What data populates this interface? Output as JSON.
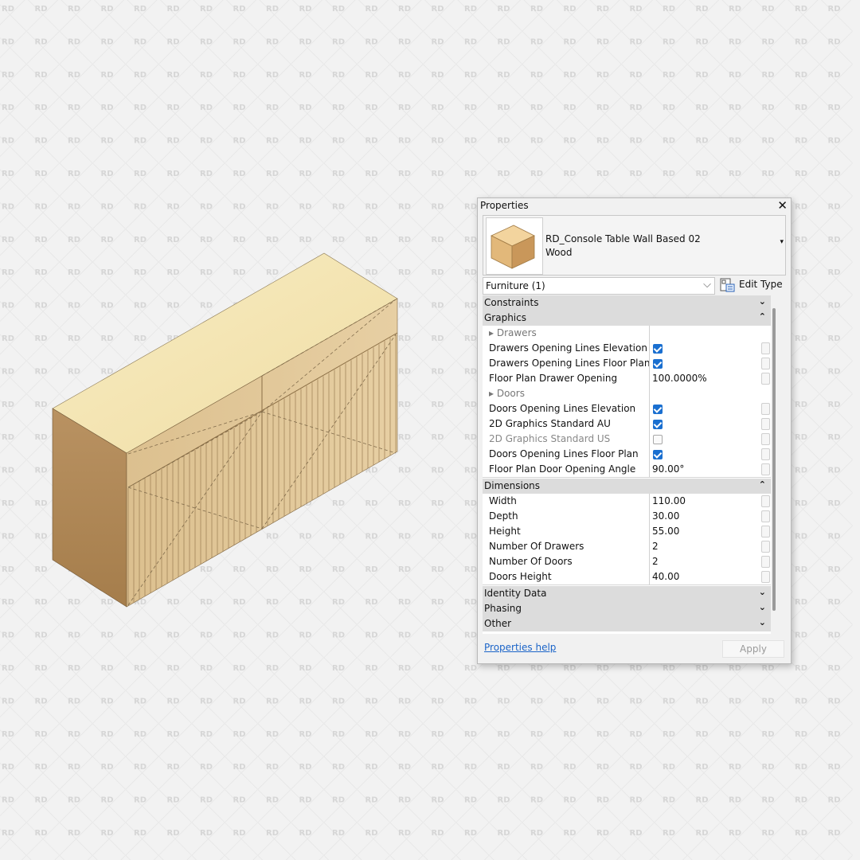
{
  "watermark": {
    "text": "RD"
  },
  "colors": {
    "accent": "#1a6fd0",
    "link": "#1b64c8",
    "wood_top": "#f4e7b2",
    "wood_front": "#e4c798",
    "wood_side": "#b18a57"
  },
  "panel": {
    "title": "Properties",
    "close_glyph": "✕",
    "type_name_line1": "RD_Console Table Wall Based 02",
    "type_name_line2": "Wood",
    "type_dropdown_glyph": "▾",
    "filter_value": "Furniture (1)",
    "filter_chevron": "⌵",
    "edit_type_label": "Edit Type",
    "help_link": "Properties help",
    "apply_label": "Apply"
  },
  "groups": {
    "constraints": {
      "label": "Constraints",
      "arrow": "⌄"
    },
    "graphics": {
      "label": "Graphics",
      "arrow": "⌃"
    },
    "dimensions": {
      "label": "Dimensions",
      "arrow": "⌃"
    },
    "identity": {
      "label": "Identity Data",
      "arrow": "⌄"
    },
    "phasing": {
      "label": "Phasing",
      "arrow": "⌄"
    },
    "other": {
      "label": "Other",
      "arrow": "⌄"
    }
  },
  "graphics_rows": [
    {
      "name": "▸ Drawers",
      "kind": "sub"
    },
    {
      "name": "Drawers Opening Lines Elevation",
      "kind": "check",
      "checked": true
    },
    {
      "name": "Drawers Opening Lines Floor Plan",
      "kind": "check",
      "checked": true
    },
    {
      "name": "Floor Plan Drawer Opening",
      "kind": "value",
      "value": "100.0000%"
    },
    {
      "name": "▸ Doors",
      "kind": "sub"
    },
    {
      "name": "Doors Opening Lines Elevation",
      "kind": "check",
      "checked": true
    },
    {
      "name": "2D Graphics Standard AU",
      "kind": "check",
      "checked": true
    },
    {
      "name": "2D Graphics Standard US",
      "kind": "check",
      "checked": false,
      "dim": true
    },
    {
      "name": "Doors Opening Lines Floor Plan",
      "kind": "check",
      "checked": true
    },
    {
      "name": "Floor Plan Door Opening Angle",
      "kind": "value",
      "value": "90.00°"
    }
  ],
  "dimension_rows": [
    {
      "name": "Width",
      "kind": "value",
      "value": "110.00"
    },
    {
      "name": "Depth",
      "kind": "value",
      "value": "30.00"
    },
    {
      "name": "Height",
      "kind": "value",
      "value": "55.00"
    },
    {
      "name": "Number Of Drawers",
      "kind": "value",
      "value": "2"
    },
    {
      "name": "Number Of Doors",
      "kind": "value",
      "value": "2"
    },
    {
      "name": "Doors Height",
      "kind": "value",
      "value": "40.00"
    }
  ]
}
